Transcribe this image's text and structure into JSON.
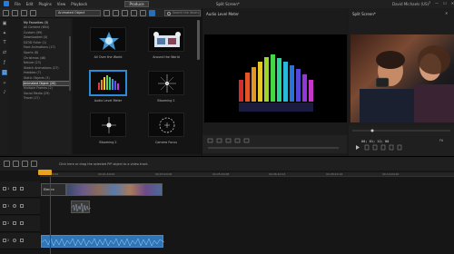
{
  "titlebar": {
    "menu": [
      "File",
      "Edit",
      "Plugins",
      "View",
      "Playback"
    ],
    "produce_label": "Produce",
    "project_title": "Split Screen*",
    "user_name": "David Michaels (US)",
    "window_controls": [
      "?",
      "—",
      "☐",
      "✕"
    ]
  },
  "toolbar": {
    "category": "Animated Object",
    "search_placeholder": "Search the library"
  },
  "categories": {
    "header": "My Favorites (0)",
    "items": [
      "All Content (694)",
      "Custom (99)",
      "Downloaded (0)",
      "DZ3D Fuller (1)",
      "Face Animations (17)",
      "Sports (8)",
      "Christmas (46)",
      "Nature (23)",
      "Sketch Animations (27)",
      "Hobbies (7)",
      "Static Objects (3)",
      "Animated Object (20)",
      "Multiple Frames (2)",
      "Social Media (29)",
      "Travel (17)"
    ],
    "selected_index": 11
  },
  "library": {
    "items": [
      {
        "label": "All Over the World",
        "icon": "blue-star-object"
      },
      {
        "label": "Around the World",
        "icon": "film-reel-object"
      },
      {
        "label": "Audio Level Meter",
        "icon": "equalizer-object"
      },
      {
        "label": "Blooming 1",
        "icon": "bloom-object"
      },
      {
        "label": "Blooming 2",
        "icon": "bloom-object"
      },
      {
        "label": "Camera Focus",
        "icon": "focus-ring-object"
      }
    ],
    "selected_index": 2
  },
  "designer": {
    "title": "Audio Level Meter"
  },
  "split": {
    "title": "Split Screen*",
    "timecode": "00; 01; 12; 00",
    "fit": "Fit"
  },
  "timeline": {
    "hint": "Click here or drag the selected PiP object to a video track.",
    "ruler_ticks": [
      "00;00;00;00",
      "00;01;40;04",
      "00;03;20;06",
      "00;05;00;08",
      "00;06;40;12",
      "00;08;20;16",
      "00;10;00;20"
    ],
    "tracks": [
      "1",
      "1",
      "2",
      "2"
    ],
    "clip_label": "Electro"
  },
  "colors": {
    "accent": "#2b8bd8",
    "playhead": "#e8a21f",
    "audio_clip": "#2f76b8"
  }
}
